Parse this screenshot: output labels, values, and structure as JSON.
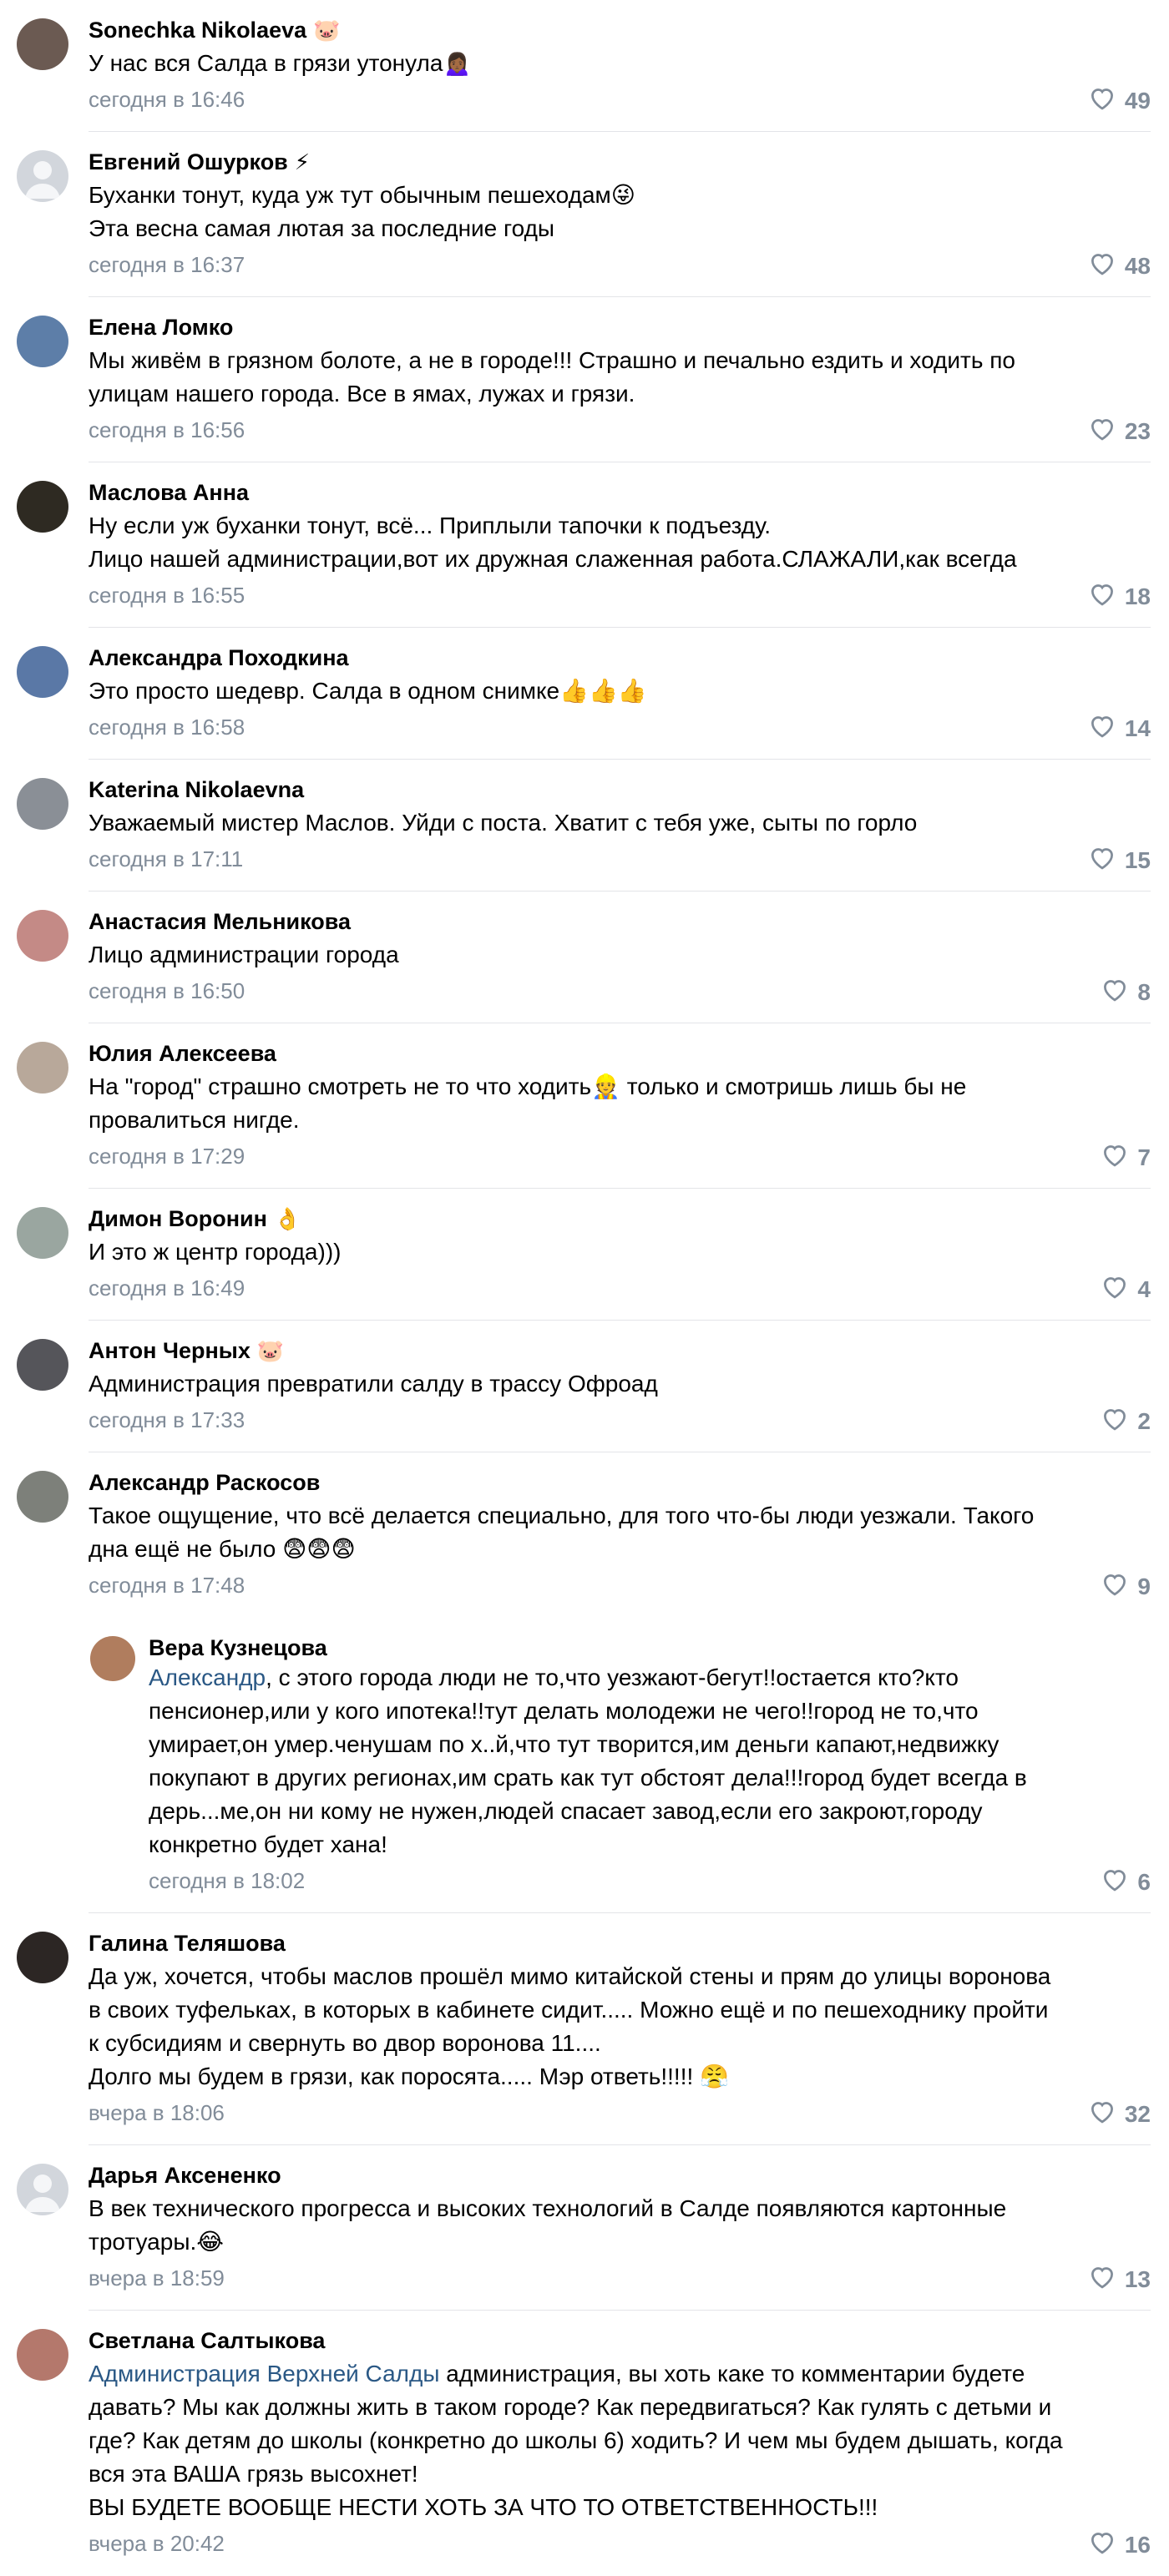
{
  "colors": {
    "mention": "#2a5885",
    "meta": "#818c99",
    "divider": "#e3e4e8"
  },
  "comments": [
    {
      "author": "Sonechka Nikolaeva",
      "badge": "🐷",
      "lines": [
        "У нас вся Салда в грязи утонула🙍🏾‍♀️"
      ],
      "time": "сегодня в 16:46",
      "likes": "49",
      "avatar_color": "#6b5a52"
    },
    {
      "author": "Евгений Ошурков",
      "badge": "⚡",
      "lines": [
        "Буханки тонут, куда уж тут обычным пешеходам😜",
        "Эта весна самая лютая за последние годы"
      ],
      "time": "сегодня в 16:37",
      "likes": "48",
      "avatar_color": "#d2d6dc"
    },
    {
      "author": "Елена Ломко",
      "badge": "",
      "lines": [
        "Мы живём в грязном болоте, а не в городе!!! Страшно и печально ездить и ходить по",
        "улицам нашего города. Все в ямах, лужах и грязи."
      ],
      "time": "сегодня в 16:56",
      "likes": "23",
      "avatar_color": "#5d7ea8"
    },
    {
      "author": "Маслова Анна",
      "badge": "",
      "lines": [
        "Ну если уж буханки тонут, всё... Приплыли тапочки к подъезду.",
        "Лицо нашей администрации,вот их дружная слаженная работа.СЛАЖАЛИ,как всегда"
      ],
      "time": "сегодня в 16:55",
      "likes": "18",
      "avatar_color": "#2e2a22"
    },
    {
      "author": "Александра Походкина",
      "badge": "",
      "lines": [
        "Это просто шедевр. Салда в одном снимке👍👍👍"
      ],
      "time": "сегодня в 16:58",
      "likes": "14",
      "avatar_color": "#5a78a6"
    },
    {
      "author": "Katerina Nikolaevna",
      "badge": "",
      "lines": [
        "Уважаемый мистер Маслов. Уйди с поста. Хватит с тебя уже, сыты по горло"
      ],
      "time": "сегодня в 17:11",
      "likes": "15",
      "avatar_color": "#8a8f96"
    },
    {
      "author": "Анастасия Мельникова",
      "badge": "",
      "lines": [
        "Лицо администрации города"
      ],
      "time": "сегодня в 16:50",
      "likes": "8",
      "avatar_color": "#c48a86"
    },
    {
      "author": "Юлия Алексеева",
      "badge": "",
      "lines": [
        "На \"город\" страшно смотреть не то что ходить👷 только и смотришь лишь бы не",
        "провалиться нигде."
      ],
      "time": "сегодня в 17:29",
      "likes": "7",
      "avatar_color": "#b8a89a"
    },
    {
      "author": "Димон Воронин",
      "badge": "👌",
      "lines": [
        "И это ж центр города)))"
      ],
      "time": "сегодня в 16:49",
      "likes": "4",
      "avatar_color": "#9aa6a0"
    },
    {
      "author": "Антон Черных",
      "badge": "🐷",
      "lines": [
        "Администрация превратили салду в трассу Офроад"
      ],
      "time": "сегодня в 17:33",
      "likes": "2",
      "avatar_color": "#55555a"
    },
    {
      "author": "Александр Раскосов",
      "badge": "",
      "lines": [
        "Такое ощущение, что всё делается специально, для того что-бы люди уезжали. Такого",
        "дна ещё не было 😨😨😨"
      ],
      "time": "сегодня в 17:48",
      "likes": "9",
      "avatar_color": "#7d807a"
    },
    {
      "author": "Вера Кузнецова",
      "badge": "",
      "reply": true,
      "mention": "Александр",
      "lines": [
        ", с этого города люди не то,что уезжают-бегут!!остается кто?кто",
        "пенсионер,или у кого ипотека!!тут делать молодежи не чего!!город не то,что",
        "умирает,он умер.ченушам по х..й,что тут творится,им деньги капают,недвижку",
        "покупают в других регионах,им срать как тут обстоят дела!!!город будет всегда в",
        "дерь...ме,он ни кому не нужен,людей спасает завод,если его закроют,городу",
        "конкретно будет хана!"
      ],
      "time": "сегодня в 18:02",
      "likes": "6",
      "avatar_color": "#b07d5e"
    },
    {
      "author": "Галина Теляшова",
      "badge": "",
      "lines": [
        "Да уж, хочется, чтобы маслов прошёл мимо китайской стены и прям до улицы воронова",
        "в своих туфельках, в которых в кабинете сидит..... Можно ещё и по пешеходнику пройти",
        "к субсидиям и свернуть во двор воронова 11....",
        "Долго мы будем в грязи, как поросята..... Мэр ответь!!!!! 😤"
      ],
      "time": "вчера в 18:06",
      "likes": "32",
      "avatar_color": "#2c2624"
    },
    {
      "author": "Дарья Аксененко",
      "badge": "",
      "lines": [
        "В век технического прогресса и высоких технологий в Салде появляются картонные",
        "тротуары.😂"
      ],
      "time": "вчера в 18:59",
      "likes": "13",
      "avatar_color": "#d2d6dc"
    },
    {
      "author": "Светлана Салтыкова",
      "badge": "",
      "mention": "Администрация Верхней Салды",
      "lines": [
        " администрация, вы хоть каке то комментарии будете",
        "давать? Мы как должны жить в таком городе? Как передвигаться? Как гулять с детьми и",
        "где? Как детям до школы (конкретно до школы 6) ходить? И чем мы будем дышать, когда",
        "вся эта ВАША грязь высохнет!",
        "ВЫ БУДЕТЕ ВООБЩЕ НЕСТИ ХОТЬ ЗА ЧТО ТО ОТВЕТСТВЕННОСТЬ!!!"
      ],
      "time": "вчера в 20:42",
      "likes": "16",
      "avatar_color": "#b4786c"
    }
  ]
}
